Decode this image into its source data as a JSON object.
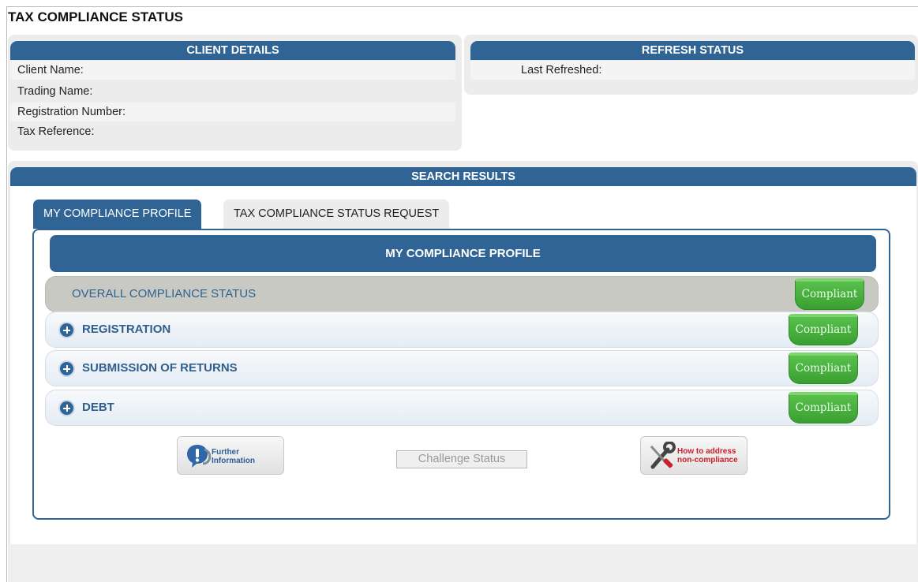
{
  "page": {
    "title": "TAX COMPLIANCE STATUS"
  },
  "client_details": {
    "header": "CLIENT DETAILS",
    "rows": [
      {
        "label": "Client Name:"
      },
      {
        "label": "Trading Name:"
      },
      {
        "label": "Registration Number:"
      },
      {
        "label": "Tax Reference:"
      }
    ]
  },
  "refresh_status": {
    "header": "REFRESH STATUS",
    "last_refreshed_label": "Last Refreshed:"
  },
  "search_results": {
    "header": "SEARCH RESULTS",
    "tabs": [
      {
        "label": "MY COMPLIANCE PROFILE",
        "active": true
      },
      {
        "label": "TAX COMPLIANCE STATUS REQUEST",
        "active": false
      }
    ],
    "profile": {
      "banner": "MY COMPLIANCE PROFILE",
      "overall": {
        "label": "OVERALL COMPLIANCE STATUS",
        "status": "Compliant"
      },
      "sections": [
        {
          "label": "REGISTRATION",
          "status": "Compliant",
          "icon": "expand-plus-icon"
        },
        {
          "label": "SUBMISSION OF RETURNS",
          "status": "Compliant",
          "icon": "expand-plus-icon"
        },
        {
          "label": "DEBT",
          "status": "Compliant",
          "icon": "expand-plus-icon"
        }
      ],
      "actions": {
        "further_info": {
          "line1": "Further",
          "line2": "Information",
          "icon": "info-bubble-icon"
        },
        "challenge": {
          "label": "Challenge Status"
        },
        "address": {
          "line1": "How to address",
          "line2": "non-compliance",
          "icon": "tools-icon"
        }
      }
    }
  },
  "colors": {
    "primary_blue": "#2f6494",
    "compliant_green": "#3a9f31",
    "panel_gray": "#ececec",
    "address_red": "#c8202a"
  }
}
